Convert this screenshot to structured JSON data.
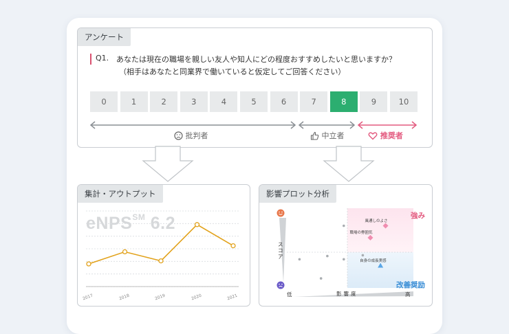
{
  "survey": {
    "tab": "アンケート",
    "question_number": "Q1.",
    "question": "あなたは現在の職場を親しい友人や知人にどの程度おすすめしたいと思いますか？",
    "question_sub": "（相手はあなたと同業界で働いていると仮定してご回答ください）",
    "scale": [
      "0",
      "1",
      "2",
      "3",
      "4",
      "5",
      "6",
      "7",
      "8",
      "9",
      "10"
    ],
    "selected": "8",
    "detractor_label": "批判者",
    "passive_label": "中立者",
    "promoter_label": "推奨者",
    "colors": {
      "selected": "#2cae70",
      "promoter": "#e35a7f",
      "arrow": "#8a8f94"
    }
  },
  "output": {
    "tab": "集計・アウトプット",
    "metric_name": "eNPS",
    "metric_mark": "SM",
    "metric_value": "6.2",
    "chart_data": {
      "type": "line",
      "x": [
        "2017",
        "2018",
        "2019",
        "2020",
        "2021"
      ],
      "values": [
        1.0,
        2.6,
        1.4,
        6.2,
        3.4
      ],
      "ylim": [
        -2,
        8
      ]
    }
  },
  "impact": {
    "tab": "影響プロット分析",
    "strength_label": "強み",
    "improve_label": "改善奨励",
    "y_axis_label": "スコア",
    "x_axis_label": "影響度",
    "x_low": "低",
    "x_high": "高",
    "chart_data": {
      "type": "scatter",
      "points": [
        {
          "x": 0.45,
          "y": 0.78,
          "label": ""
        },
        {
          "x": 0.32,
          "y": 0.4,
          "label": ""
        },
        {
          "x": 0.1,
          "y": 0.36,
          "label": ""
        },
        {
          "x": 0.45,
          "y": 0.36,
          "label": ""
        },
        {
          "x": 0.6,
          "y": 0.41,
          "label": ""
        },
        {
          "x": 0.27,
          "y": 0.12,
          "label": ""
        },
        {
          "x": 0.78,
          "y": 0.78,
          "label": "風通しのよさ",
          "kind": "strength"
        },
        {
          "x": 0.66,
          "y": 0.63,
          "label": "職場の雰囲気",
          "kind": "strength"
        },
        {
          "x": 0.74,
          "y": 0.28,
          "label": "自身の成長実感",
          "kind": "improve"
        }
      ]
    }
  }
}
